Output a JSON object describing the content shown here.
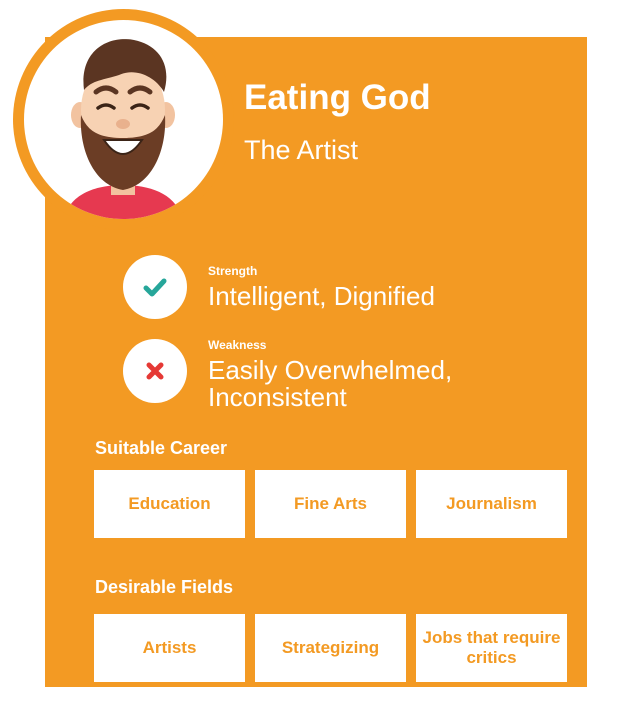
{
  "profile": {
    "name": "Eating God",
    "subtitle": "The Artist",
    "avatar_icon": "bearded-man-avatar-icon"
  },
  "traits": {
    "strength": {
      "label": "Strength",
      "value": "Intelligent, Dignified",
      "icon": "check-icon",
      "icon_color": "#26a69a"
    },
    "weakness": {
      "label": "Weakness",
      "value_line1": "Easily Overwhelmed,",
      "value_line2": "Inconsistent",
      "icon": "cross-icon",
      "icon_color": "#e53935"
    }
  },
  "careers": {
    "title": "Suitable Career",
    "items": [
      "Education",
      "Fine Arts",
      "Journalism"
    ]
  },
  "fields": {
    "title": "Desirable Fields",
    "items": [
      "Artists",
      "Strategizing",
      "Jobs that require critics"
    ]
  },
  "colors": {
    "accent": "#f39a23",
    "card_text": "#ffffff"
  }
}
